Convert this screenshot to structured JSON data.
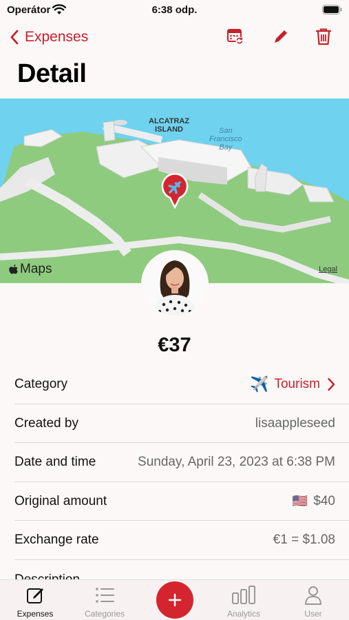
{
  "status_bar": {
    "carrier": "Operátor",
    "time": "6:38 odp."
  },
  "nav": {
    "back_label": "Expenses",
    "icons": [
      "calendar-sync-icon",
      "pencil-icon",
      "trash-icon"
    ]
  },
  "page": {
    "title": "Detail"
  },
  "map": {
    "place_label_line1": "ALCATRAZ",
    "place_label_line2": "ISLAND",
    "water_label_line1": "San",
    "water_label_line2": "Francisco",
    "water_label_line3": "Bay",
    "brand": "Maps",
    "legal": "Legal",
    "pin_icon": "airplane-icon"
  },
  "expense": {
    "amount": "€37",
    "rows": [
      {
        "label": "Category",
        "value": "Tourism",
        "emoji": "✈️",
        "link": true
      },
      {
        "label": "Created by",
        "value": "lisaappleseed"
      },
      {
        "label": "Date and time",
        "value": "Sunday, April 23, 2023 at 6:38 PM"
      },
      {
        "label": "Original amount",
        "value": "$40",
        "emoji": "🇺🇸"
      },
      {
        "label": "Exchange rate",
        "value": "€1 = $1.08"
      }
    ],
    "partial_row_label": "Description"
  },
  "tabbar": {
    "tabs": [
      {
        "label": "Expenses",
        "icon": "compose-icon",
        "active": true
      },
      {
        "label": "Categories",
        "icon": "list-icon",
        "active": false
      },
      {
        "label": "Analytics",
        "icon": "bar-chart-icon",
        "active": false
      },
      {
        "label": "User",
        "icon": "person-icon",
        "active": false
      }
    ],
    "add_icon": "plus-icon"
  },
  "colors": {
    "accent": "#c8202b",
    "water": "#6fd2ee",
    "land": "#8ecb7e",
    "background": "#fcf8f7"
  }
}
